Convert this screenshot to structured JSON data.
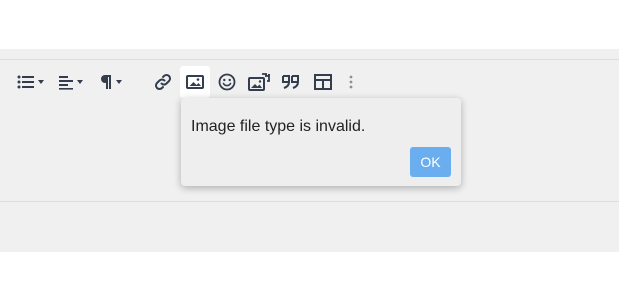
{
  "toolbar": {
    "buttons": [
      {
        "name": "list-icon",
        "has_dropdown": true
      },
      {
        "name": "align-icon",
        "has_dropdown": true
      },
      {
        "name": "paragraph-icon",
        "has_dropdown": true
      },
      {
        "name": "link-icon"
      },
      {
        "name": "image-icon",
        "active": true
      },
      {
        "name": "smiley-icon"
      },
      {
        "name": "media-gallery-icon"
      },
      {
        "name": "quote-icon"
      },
      {
        "name": "table-icon"
      },
      {
        "name": "more-vertical-icon"
      }
    ],
    "icon_color": "#333d4d"
  },
  "dialog": {
    "message": "Image file type is invalid.",
    "ok_label": "OK",
    "ok_color": "#6aaef0"
  }
}
